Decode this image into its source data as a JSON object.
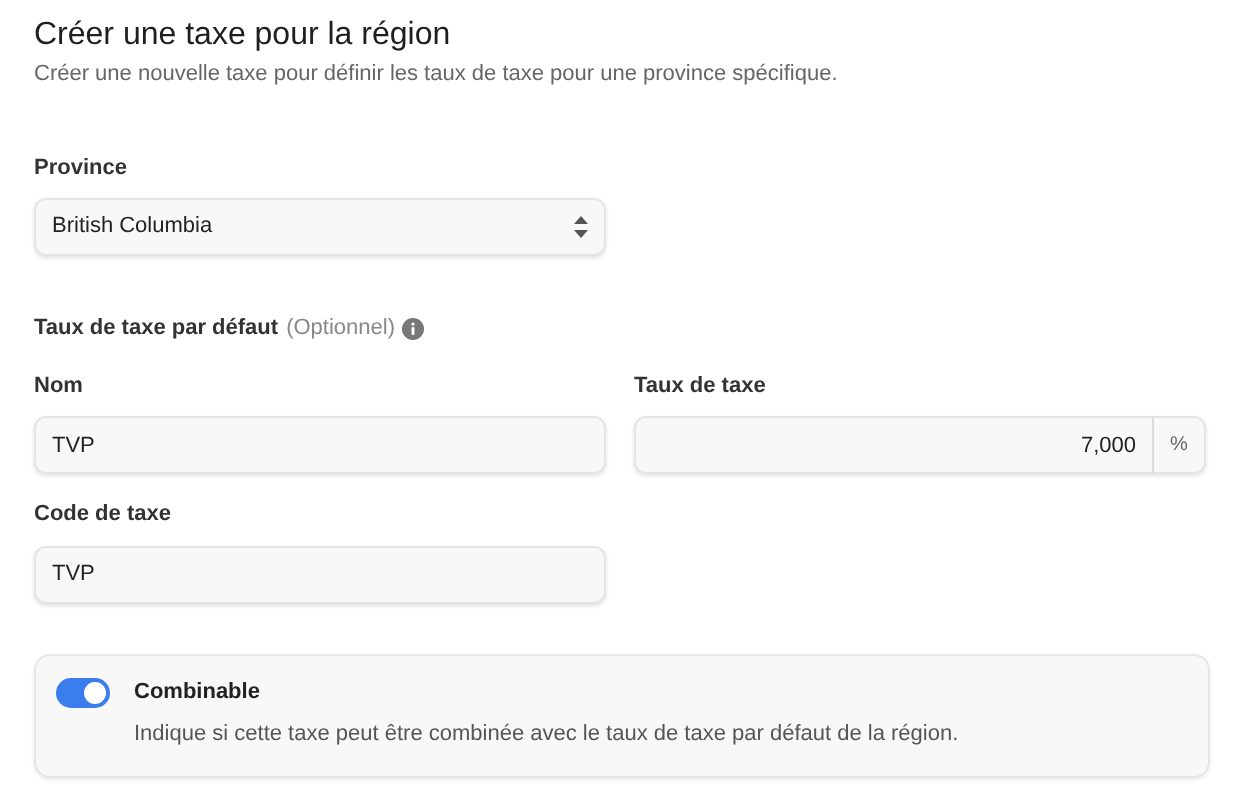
{
  "header": {
    "title": "Créer une taxe pour la région",
    "subtitle": "Créer une nouvelle taxe pour définir les taux de taxe pour une province spécifique."
  },
  "province": {
    "label": "Province",
    "value": "British Columbia"
  },
  "default_rate": {
    "label": "Taux de taxe par défaut",
    "optional": "(Optionnel)",
    "name": {
      "label": "Nom",
      "value": "TVP"
    },
    "rate": {
      "label": "Taux de taxe",
      "value": "7,000",
      "suffix": "%"
    },
    "code": {
      "label": "Code de taxe",
      "value": "TVP"
    }
  },
  "combinable": {
    "label": "Combinable",
    "description": "Indique si cette taxe peut être combinée avec le taux de taxe par défaut de la région.",
    "on": true
  }
}
